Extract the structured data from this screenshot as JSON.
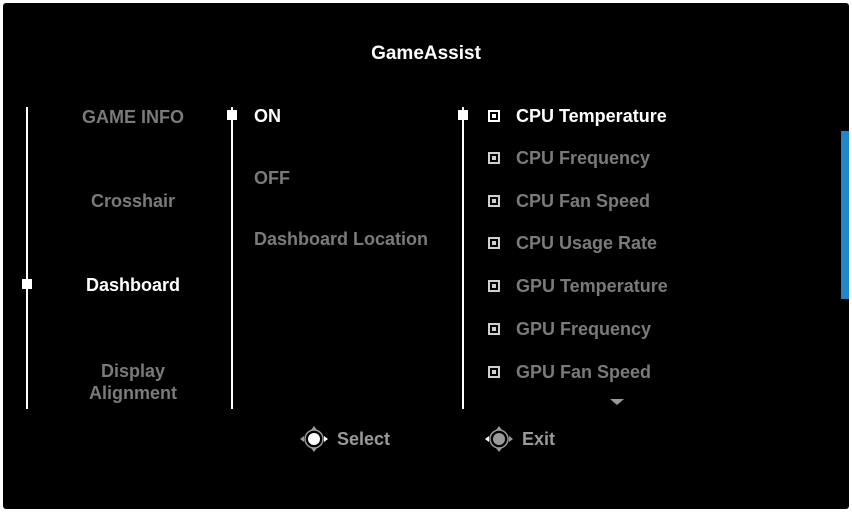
{
  "header": {
    "title": "GameAssist"
  },
  "categories": [
    {
      "label": "GAME INFO"
    },
    {
      "label": "Crosshair"
    },
    {
      "label": "Dashboard"
    },
    {
      "label": "Display Alignment"
    }
  ],
  "selected_category": "Dashboard",
  "options": [
    {
      "label": "ON"
    },
    {
      "label": "OFF"
    },
    {
      "label": "Dashboard Location"
    }
  ],
  "selected_option": "ON",
  "items": [
    {
      "label": "CPU Temperature"
    },
    {
      "label": "CPU Frequency"
    },
    {
      "label": "CPU Fan Speed"
    },
    {
      "label": "CPU Usage Rate"
    },
    {
      "label": "GPU Temperature"
    },
    {
      "label": "GPU Frequency"
    },
    {
      "label": "GPU Fan Speed"
    }
  ],
  "selected_item": "CPU Temperature",
  "hints": {
    "select": {
      "icon": "joystick-icon",
      "label": "Select"
    },
    "exit": {
      "icon": "joystick-left-icon",
      "label": "Exit"
    }
  },
  "colors": {
    "accent": "#1f86c9",
    "background": "#000000",
    "selected_text": "#ffffff",
    "dim_text": "#7a7a7a"
  }
}
